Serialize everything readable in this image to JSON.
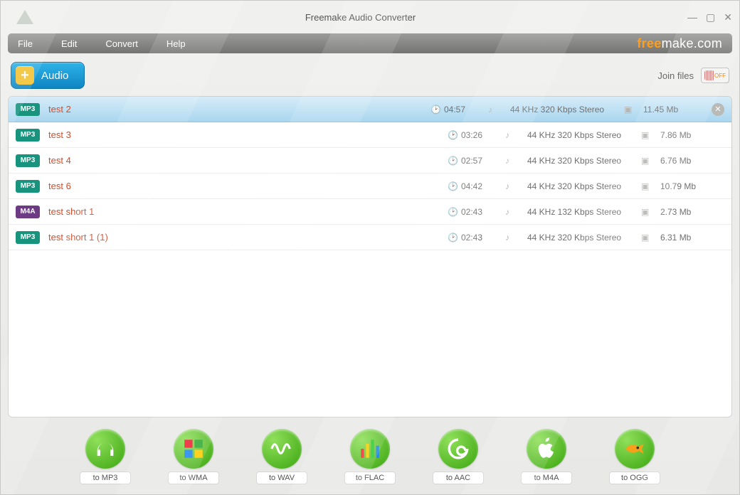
{
  "window": {
    "title": "Freemake Audio Converter"
  },
  "menu": {
    "file": "File",
    "edit": "Edit",
    "convert": "Convert",
    "help": "Help"
  },
  "brand": {
    "left": "free",
    "mid": "make",
    "right": ".com"
  },
  "toolbar": {
    "audio": "Audio",
    "join": "Join files",
    "join_state": "OFF"
  },
  "files": [
    {
      "type": "MP3",
      "name": "test 2",
      "dur": "04:57",
      "specs": "44 KHz  320 Kbps  Stereo",
      "size": "11.45 Mb",
      "selected": true
    },
    {
      "type": "MP3",
      "name": "test 3",
      "dur": "03:26",
      "specs": "44 KHz  320 Kbps  Stereo",
      "size": "7.86 Mb",
      "selected": false
    },
    {
      "type": "MP3",
      "name": "test 4",
      "dur": "02:57",
      "specs": "44 KHz  320 Kbps  Stereo",
      "size": "6.76 Mb",
      "selected": false
    },
    {
      "type": "MP3",
      "name": "test 6",
      "dur": "04:42",
      "specs": "44 KHz  320 Kbps  Stereo",
      "size": "10.79 Mb",
      "selected": false
    },
    {
      "type": "M4A",
      "name": "test short 1",
      "dur": "02:43",
      "specs": "44 KHz  132 Kbps  Stereo",
      "size": "2.73 Mb",
      "selected": false
    },
    {
      "type": "MP3",
      "name": "test short 1 (1)",
      "dur": "02:43",
      "specs": "44 KHz  320 Kbps  Stereo",
      "size": "6.31 Mb",
      "selected": false
    }
  ],
  "converters": [
    {
      "label": "to MP3",
      "icon": "headphones"
    },
    {
      "label": "to WMA",
      "icon": "windows"
    },
    {
      "label": "to WAV",
      "icon": "wave"
    },
    {
      "label": "to FLAC",
      "icon": "equalizer"
    },
    {
      "label": "to AAC",
      "icon": "swirl"
    },
    {
      "label": "to M4A",
      "icon": "apple"
    },
    {
      "label": "to OGG",
      "icon": "fish"
    }
  ]
}
